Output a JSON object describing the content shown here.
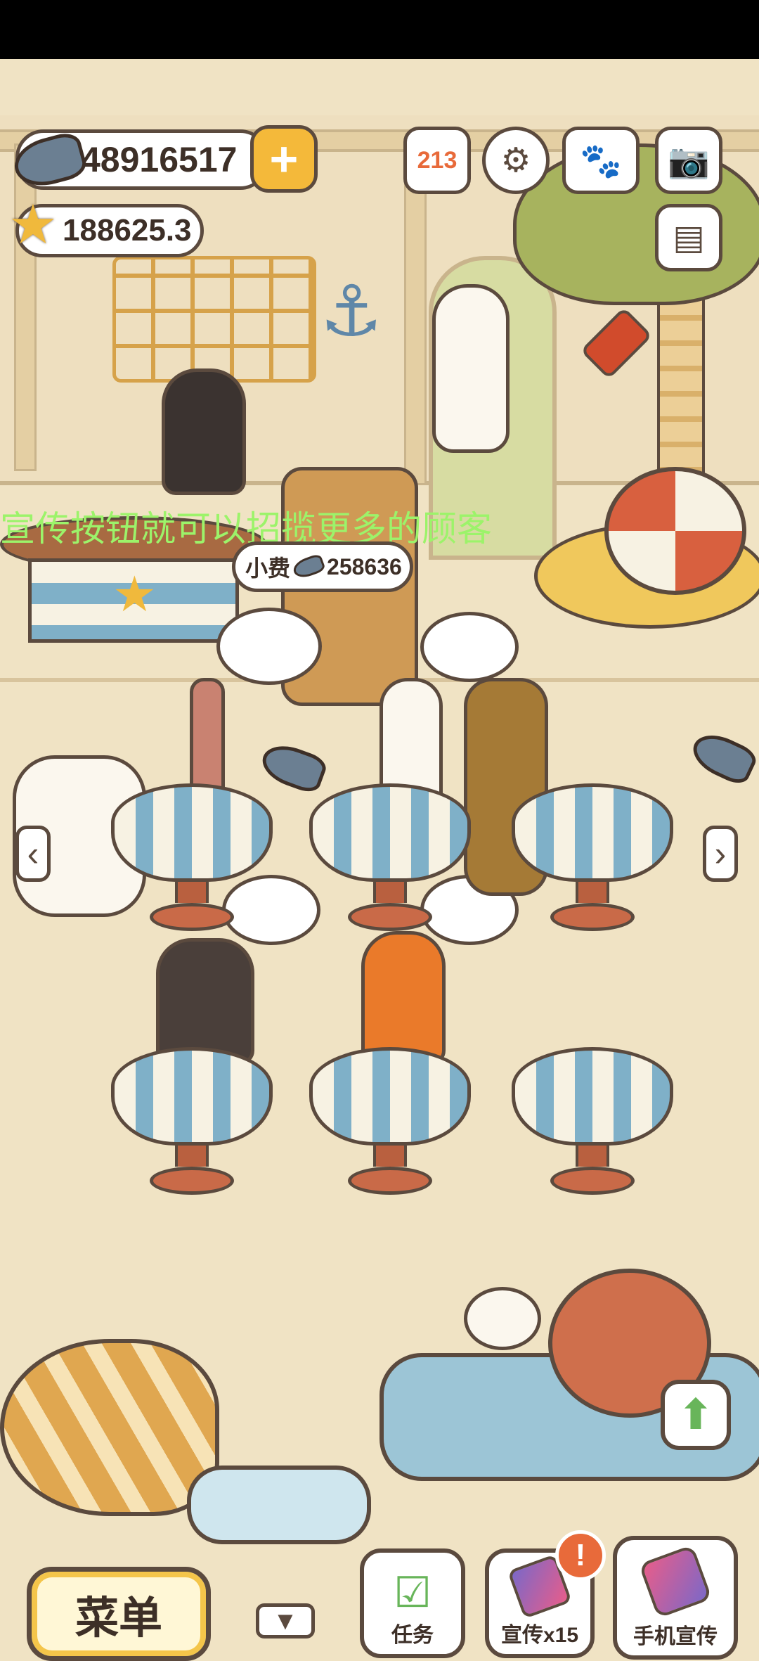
{
  "currency": {
    "fish_amount": "48916517",
    "star_amount": "188625.3"
  },
  "top_icons": [
    "ranking-icon",
    "settings-icon",
    "album-icon",
    "camera-icon",
    "newspaper-icon"
  ],
  "ranking_digits": "213",
  "scrolling_hint": "宣传按钮就可以招揽更多的顾客",
  "tip": {
    "label": "小费",
    "amount": "258636"
  },
  "bottom_bar": {
    "menu_label": "菜单",
    "task_label": "任务",
    "promo_label": "宣传x15",
    "phone_promo_label": "手机宣传",
    "alert_badge": "!"
  },
  "colors": {
    "background": "#f0e3c4",
    "outline": "#5b4a3e",
    "accent_yellow": "#f4b93a",
    "hint_green": "#9cf36a",
    "table_stripe": "#7fb0c8"
  }
}
